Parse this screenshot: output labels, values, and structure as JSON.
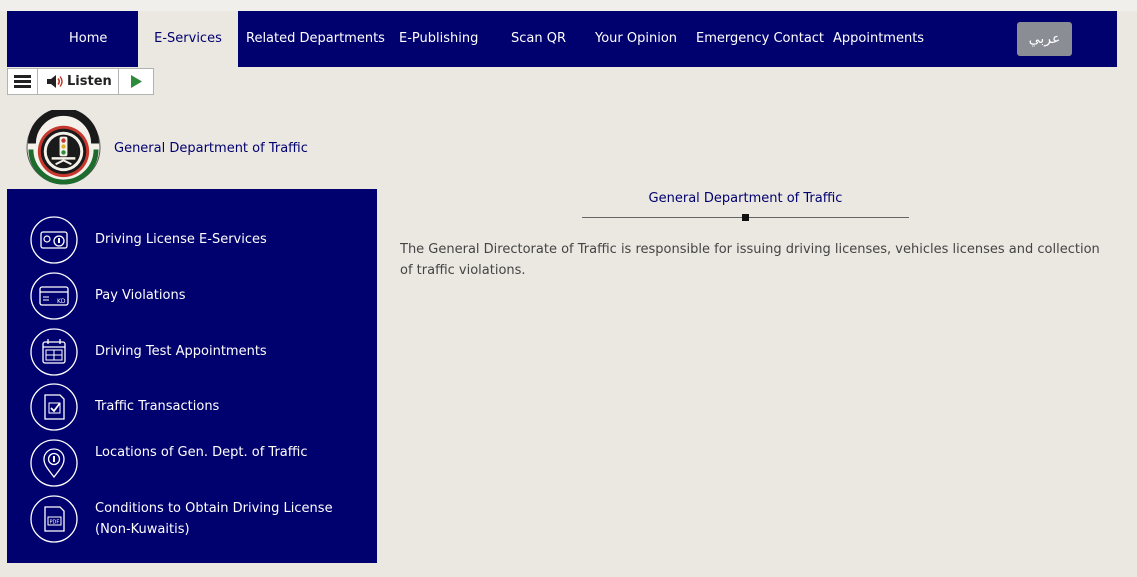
{
  "nav": {
    "items": [
      {
        "label": "Home"
      },
      {
        "label": "E-Services"
      },
      {
        "label": "Related Departments"
      },
      {
        "label": "E-Publishing"
      },
      {
        "label": "Scan QR"
      },
      {
        "label": "Your Opinion"
      },
      {
        "label": "Emergency Contact"
      },
      {
        "label": "Appointments"
      }
    ],
    "active": "E-Services",
    "language_button": "عربي"
  },
  "listen_bar": {
    "listen_label": "Listen",
    "icons": [
      "menu-icon",
      "speaker-icon",
      "play-icon"
    ]
  },
  "brand": {
    "title": "General Department of Traffic"
  },
  "sidebar": {
    "items": [
      {
        "label": "Driving License E-Services",
        "icon": "license-card-icon"
      },
      {
        "label": "Pay Violations",
        "icon": "kd-card-icon"
      },
      {
        "label": "Driving Test Appointments",
        "icon": "calendar-icon"
      },
      {
        "label": " Traffic Transactions",
        "icon": "document-check-icon"
      },
      {
        "label": " Locations of Gen. Dept. of Traffic",
        "icon": "location-pin-icon"
      },
      {
        "label": "Conditions to Obtain Driving License (Non-Kuwaitis)",
        "icon": "pdf-document-icon"
      }
    ]
  },
  "content": {
    "title": "General Department of Traffic",
    "body": "The General Directorate of Traffic is responsible for issuing driving licenses, vehicles licenses and collection of traffic violations."
  },
  "colors": {
    "navy": "#00006e",
    "page_background": "#ebe8e2",
    "language_button": "#8a8d93",
    "play_green": "#2e8b3a"
  }
}
